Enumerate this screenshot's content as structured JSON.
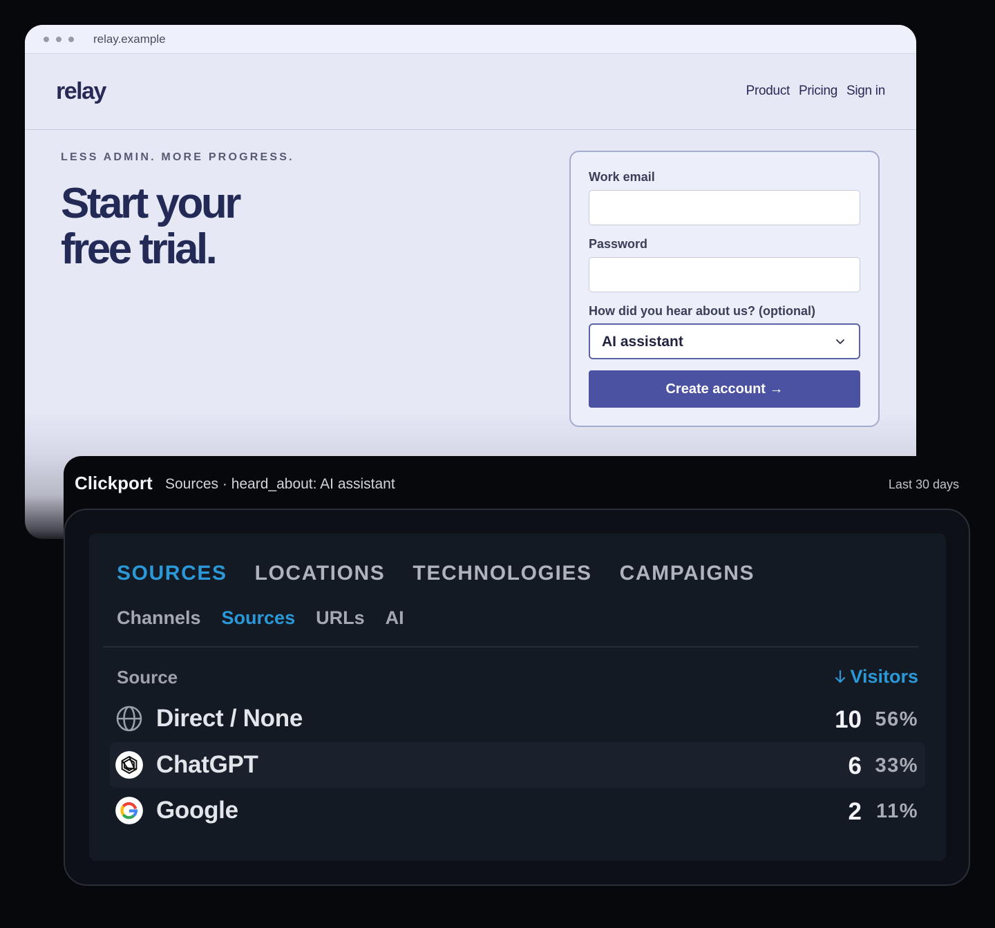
{
  "browser": {
    "url": "relay.example",
    "logo": "relay",
    "nav": [
      "Product",
      "Pricing",
      "Sign in"
    ]
  },
  "hero": {
    "eyebrow": "LESS ADMIN. MORE PROGRESS.",
    "title_line1": "Start your",
    "title_line2": "free trial."
  },
  "form": {
    "email_label": "Work email",
    "email_value": "",
    "password_label": "Password",
    "password_value": "",
    "source_label": "How did you hear about us? (optional)",
    "source_value": "AI assistant",
    "submit_label": "Create account →"
  },
  "dashboard": {
    "brand": "Clickport",
    "breadcrumb": "Sources · heard_about: AI assistant",
    "range": "Last 30 days",
    "tabs": [
      {
        "label": "SOURCES",
        "active": true
      },
      {
        "label": "LOCATIONS",
        "active": false
      },
      {
        "label": "TECHNOLOGIES",
        "active": false
      },
      {
        "label": "CAMPAIGNS",
        "active": false
      }
    ],
    "subtabs": [
      {
        "label": "Channels",
        "active": false
      },
      {
        "label": "Sources",
        "active": true
      },
      {
        "label": "URLs",
        "active": false
      },
      {
        "label": "AI",
        "active": false
      }
    ],
    "columns": {
      "source": "Source",
      "visitors": "Visitors"
    },
    "rows": [
      {
        "name": "Direct / None",
        "visitors": "10",
        "percent": "56%",
        "icon": "globe-icon"
      },
      {
        "name": "ChatGPT",
        "visitors": "6",
        "percent": "33%",
        "icon": "chatgpt-icon"
      },
      {
        "name": "Google",
        "visitors": "2",
        "percent": "11%",
        "icon": "google-icon"
      }
    ],
    "accent_color": "#2b98d8"
  }
}
